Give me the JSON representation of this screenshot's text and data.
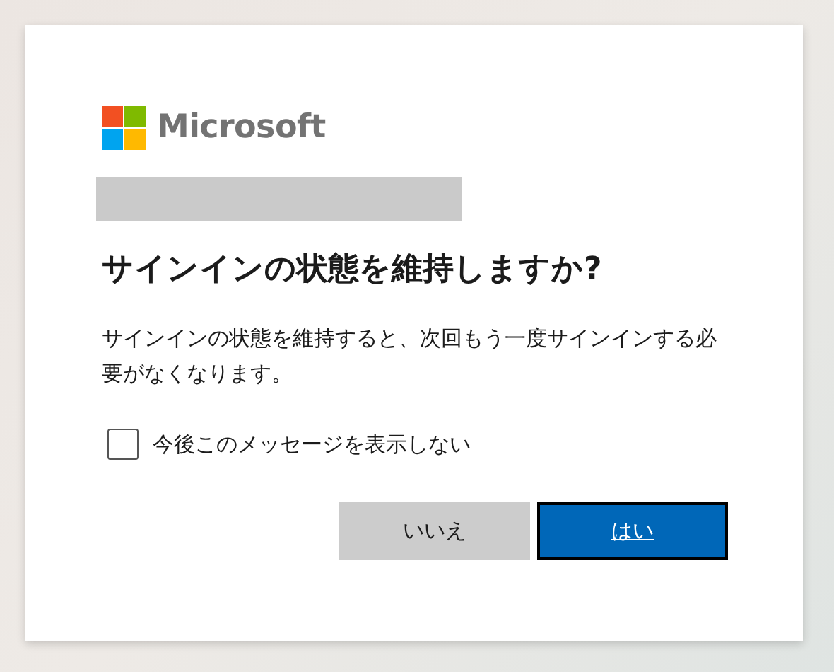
{
  "logo": {
    "text": "Microsoft"
  },
  "title": "サインインの状態を維持しますか?",
  "description": "サインインの状態を維持すると、次回もう一度サインインする必要がなくなります。",
  "checkbox": {
    "label": "今後このメッセージを表示しない",
    "checked": false
  },
  "buttons": [
    {
      "label": "いいえ",
      "kind": "secondary",
      "focused": false
    },
    {
      "label": "はい",
      "kind": "primary",
      "focused": true
    }
  ]
}
